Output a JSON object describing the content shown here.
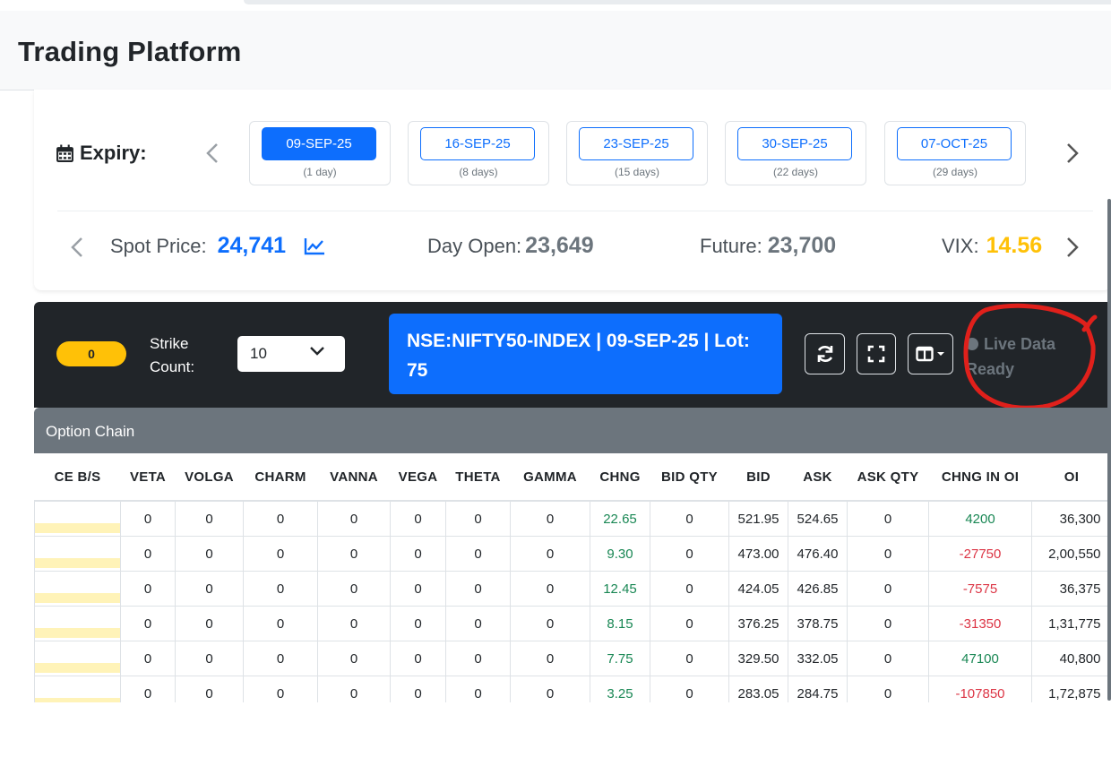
{
  "header": {
    "title": "Trading Platform"
  },
  "expiry": {
    "label": "Expiry:",
    "items": [
      {
        "date": "09-SEP-25",
        "days": "(1 day)",
        "active": true
      },
      {
        "date": "16-SEP-25",
        "days": "(8 days)"
      },
      {
        "date": "23-SEP-25",
        "days": "(15 days)"
      },
      {
        "date": "30-SEP-25",
        "days": "(22 days)"
      },
      {
        "date": "07-OCT-25",
        "days": "(29 days)"
      }
    ]
  },
  "metrics": {
    "spot_label": "Spot Price:",
    "spot_value": "24,741",
    "open_label": "Day Open:",
    "open_value": "23,649",
    "future_label": "Future:",
    "future_value": "23,700",
    "vix_label": "VIX:",
    "vix_value": "14.56"
  },
  "toolbar": {
    "badge": "0",
    "strike_label": "Strike Count:",
    "strike_value": "10",
    "symbol": "NSE:NIFTY50-INDEX | 09-SEP-25 | Lot: 75",
    "status": "Live Data Ready"
  },
  "chain": {
    "title": "Option Chain",
    "columns": [
      "CE B/S",
      "VETA",
      "VOLGA",
      "CHARM",
      "VANNA",
      "VEGA",
      "THETA",
      "GAMMA",
      "CHNG",
      "BID QTY",
      "BID",
      "ASK",
      "ASK QTY",
      "CHNG IN OI",
      "OI"
    ],
    "rows": [
      [
        "",
        "0",
        "0",
        "0",
        "0",
        "0",
        "0",
        "0",
        "22.65",
        "0",
        "521.95",
        "524.65",
        "0",
        "4200",
        "36,300"
      ],
      [
        "",
        "0",
        "0",
        "0",
        "0",
        "0",
        "0",
        "0",
        "9.30",
        "0",
        "473.00",
        "476.40",
        "0",
        "-27750",
        "2,00,550"
      ],
      [
        "",
        "0",
        "0",
        "0",
        "0",
        "0",
        "0",
        "0",
        "12.45",
        "0",
        "424.05",
        "426.85",
        "0",
        "-7575",
        "36,375"
      ],
      [
        "",
        "0",
        "0",
        "0",
        "0",
        "0",
        "0",
        "0",
        "8.15",
        "0",
        "376.25",
        "378.75",
        "0",
        "-31350",
        "1,31,775"
      ],
      [
        "",
        "0",
        "0",
        "0",
        "0",
        "0",
        "0",
        "0",
        "7.75",
        "0",
        "329.50",
        "332.05",
        "0",
        "47100",
        "40,800"
      ],
      [
        "",
        "0",
        "0",
        "0",
        "0",
        "0",
        "0",
        "0",
        "3.25",
        "0",
        "283.05",
        "284.75",
        "0",
        "-107850",
        "1,72,875"
      ]
    ]
  },
  "colors": {
    "primary": "#0d6efd",
    "warning": "#ffc107",
    "positive": "#198754",
    "negative": "#dc3545",
    "annotation": "#e0201b"
  }
}
